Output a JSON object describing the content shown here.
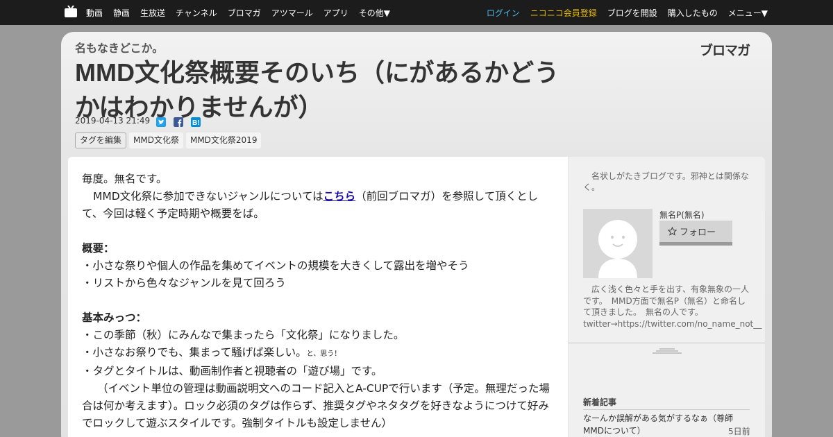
{
  "topbar": {
    "logo": "niconico-tv-icon",
    "nav_left": [
      "動画",
      "静画",
      "生放送",
      "チャンネル",
      "ブロマガ",
      "アツマール",
      "アプリ",
      "その他▼"
    ],
    "login": "ログイン",
    "premium": "ニコニコ会員登録",
    "open_blog": "ブログを開設",
    "purchased": "購入したもの",
    "menu": "メニュー▼"
  },
  "header": {
    "blog_name": "名もなきどこか。",
    "brand": "ブロマガ",
    "title": "MMD文化祭概要そのいち（にがあるかどうかはわかりませんが）",
    "date": "2019-04-13 21:49",
    "share": [
      {
        "name": "twitter",
        "color": "#1da1f2"
      },
      {
        "name": "facebook",
        "color": "#3b5998"
      },
      {
        "name": "hatena",
        "color": "#008fde"
      }
    ],
    "tags": [
      "タグを編集",
      "MMD文化祭",
      "MMD文化祭2019"
    ]
  },
  "article": {
    "line1": "毎度。無名です。",
    "line2_pre": "MMD文化祭に参加できないジャンルについては",
    "line2_link": "こちら",
    "line2_post": "（前回ブロマガ）を参照して頂くとして、今回は軽く予定時期や概要をば。",
    "heading1": "概要：",
    "list1": [
      "・小さな祭りや個人の作品を集めてイベントの規模を大きくして露出を増やそう",
      "・リストから色々なジャンルを見て回ろう"
    ],
    "heading2": "基本みっつ：",
    "list2_a": "・この季節（秋）にみんなで集まったら「文化祭」になりました。",
    "list2_b": "・小さなお祭りでも、集まって騒げば楽しい。",
    "list2_b_small": "と、思う！",
    "list2_c": "・タグとタイトルは、動画制作者と視聴者の「遊び場」です。",
    "note": "（イベント単位の管理は動画説明文へのコード記入とA-CUPで行います（予定。無理だった場合は何か考えます）。ロック必須のタグは作らず、推奨タグやネタタグを好きなようにつけて好みでロックして遊ぶスタイルです。強制タイトルも設定しません）"
  },
  "sidebar": {
    "description": "名状しがたきブログです。邪神とは関係なく。",
    "user_name": "無名P(無名)",
    "follow": "フォロー",
    "profile": "広く浅く色々と手を出す、有象無象の一人です。　MMD方面で無名P（無名）と命名して頂きました。　無名の人です。 twitter→https://twitter.com/no_name_not__",
    "recent_heading": "新着記事",
    "recent_title": "なーんか誤解がある気がするなぁ（尊師MMDについて）",
    "recent_date": "5日前"
  }
}
